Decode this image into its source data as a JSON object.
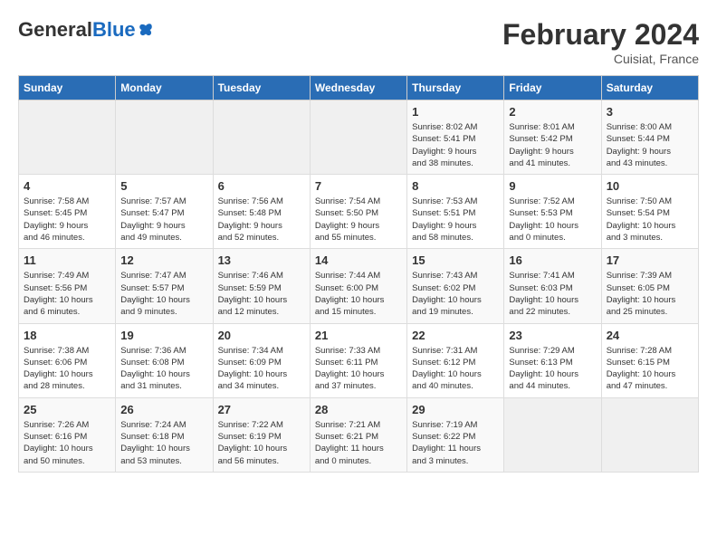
{
  "header": {
    "logo_general": "General",
    "logo_blue": "Blue",
    "month_year": "February 2024",
    "location": "Cuisiat, France"
  },
  "days_of_week": [
    "Sunday",
    "Monday",
    "Tuesday",
    "Wednesday",
    "Thursday",
    "Friday",
    "Saturday"
  ],
  "weeks": [
    {
      "days": [
        {
          "num": "",
          "info": "",
          "empty": true
        },
        {
          "num": "",
          "info": "",
          "empty": true
        },
        {
          "num": "",
          "info": "",
          "empty": true
        },
        {
          "num": "",
          "info": "",
          "empty": true
        },
        {
          "num": "1",
          "info": "Sunrise: 8:02 AM\nSunset: 5:41 PM\nDaylight: 9 hours\nand 38 minutes."
        },
        {
          "num": "2",
          "info": "Sunrise: 8:01 AM\nSunset: 5:42 PM\nDaylight: 9 hours\nand 41 minutes."
        },
        {
          "num": "3",
          "info": "Sunrise: 8:00 AM\nSunset: 5:44 PM\nDaylight: 9 hours\nand 43 minutes."
        }
      ]
    },
    {
      "days": [
        {
          "num": "4",
          "info": "Sunrise: 7:58 AM\nSunset: 5:45 PM\nDaylight: 9 hours\nand 46 minutes."
        },
        {
          "num": "5",
          "info": "Sunrise: 7:57 AM\nSunset: 5:47 PM\nDaylight: 9 hours\nand 49 minutes."
        },
        {
          "num": "6",
          "info": "Sunrise: 7:56 AM\nSunset: 5:48 PM\nDaylight: 9 hours\nand 52 minutes."
        },
        {
          "num": "7",
          "info": "Sunrise: 7:54 AM\nSunset: 5:50 PM\nDaylight: 9 hours\nand 55 minutes."
        },
        {
          "num": "8",
          "info": "Sunrise: 7:53 AM\nSunset: 5:51 PM\nDaylight: 9 hours\nand 58 minutes."
        },
        {
          "num": "9",
          "info": "Sunrise: 7:52 AM\nSunset: 5:53 PM\nDaylight: 10 hours\nand 0 minutes."
        },
        {
          "num": "10",
          "info": "Sunrise: 7:50 AM\nSunset: 5:54 PM\nDaylight: 10 hours\nand 3 minutes."
        }
      ]
    },
    {
      "days": [
        {
          "num": "11",
          "info": "Sunrise: 7:49 AM\nSunset: 5:56 PM\nDaylight: 10 hours\nand 6 minutes."
        },
        {
          "num": "12",
          "info": "Sunrise: 7:47 AM\nSunset: 5:57 PM\nDaylight: 10 hours\nand 9 minutes."
        },
        {
          "num": "13",
          "info": "Sunrise: 7:46 AM\nSunset: 5:59 PM\nDaylight: 10 hours\nand 12 minutes."
        },
        {
          "num": "14",
          "info": "Sunrise: 7:44 AM\nSunset: 6:00 PM\nDaylight: 10 hours\nand 15 minutes."
        },
        {
          "num": "15",
          "info": "Sunrise: 7:43 AM\nSunset: 6:02 PM\nDaylight: 10 hours\nand 19 minutes."
        },
        {
          "num": "16",
          "info": "Sunrise: 7:41 AM\nSunset: 6:03 PM\nDaylight: 10 hours\nand 22 minutes."
        },
        {
          "num": "17",
          "info": "Sunrise: 7:39 AM\nSunset: 6:05 PM\nDaylight: 10 hours\nand 25 minutes."
        }
      ]
    },
    {
      "days": [
        {
          "num": "18",
          "info": "Sunrise: 7:38 AM\nSunset: 6:06 PM\nDaylight: 10 hours\nand 28 minutes."
        },
        {
          "num": "19",
          "info": "Sunrise: 7:36 AM\nSunset: 6:08 PM\nDaylight: 10 hours\nand 31 minutes."
        },
        {
          "num": "20",
          "info": "Sunrise: 7:34 AM\nSunset: 6:09 PM\nDaylight: 10 hours\nand 34 minutes."
        },
        {
          "num": "21",
          "info": "Sunrise: 7:33 AM\nSunset: 6:11 PM\nDaylight: 10 hours\nand 37 minutes."
        },
        {
          "num": "22",
          "info": "Sunrise: 7:31 AM\nSunset: 6:12 PM\nDaylight: 10 hours\nand 40 minutes."
        },
        {
          "num": "23",
          "info": "Sunrise: 7:29 AM\nSunset: 6:13 PM\nDaylight: 10 hours\nand 44 minutes."
        },
        {
          "num": "24",
          "info": "Sunrise: 7:28 AM\nSunset: 6:15 PM\nDaylight: 10 hours\nand 47 minutes."
        }
      ]
    },
    {
      "days": [
        {
          "num": "25",
          "info": "Sunrise: 7:26 AM\nSunset: 6:16 PM\nDaylight: 10 hours\nand 50 minutes."
        },
        {
          "num": "26",
          "info": "Sunrise: 7:24 AM\nSunset: 6:18 PM\nDaylight: 10 hours\nand 53 minutes."
        },
        {
          "num": "27",
          "info": "Sunrise: 7:22 AM\nSunset: 6:19 PM\nDaylight: 10 hours\nand 56 minutes."
        },
        {
          "num": "28",
          "info": "Sunrise: 7:21 AM\nSunset: 6:21 PM\nDaylight: 11 hours\nand 0 minutes."
        },
        {
          "num": "29",
          "info": "Sunrise: 7:19 AM\nSunset: 6:22 PM\nDaylight: 11 hours\nand 3 minutes."
        },
        {
          "num": "",
          "info": "",
          "empty": true
        },
        {
          "num": "",
          "info": "",
          "empty": true
        }
      ]
    }
  ]
}
